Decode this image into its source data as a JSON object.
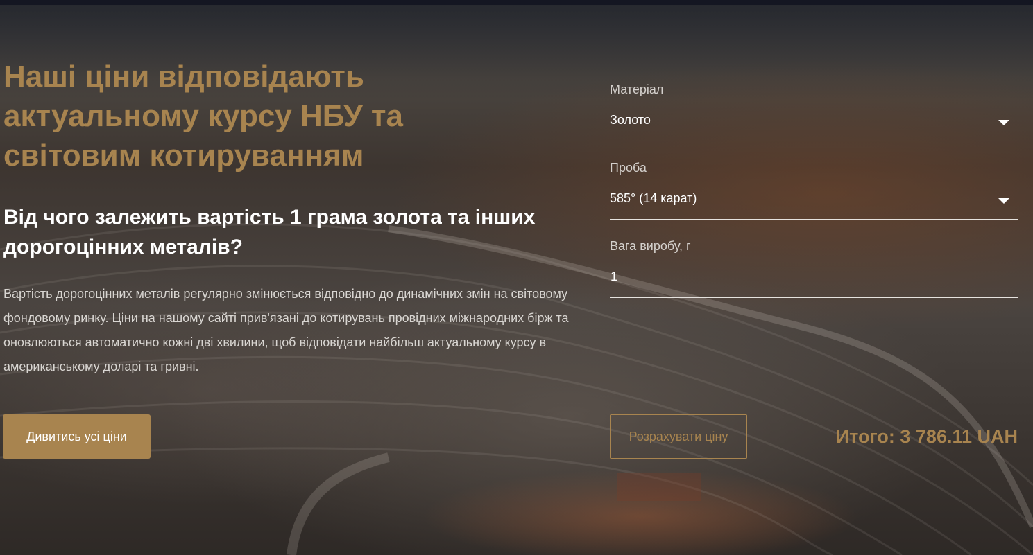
{
  "hero": {
    "title": "Наші ціни відповідають актуальному курсу НБУ та світовим котируванням",
    "subtitle": "Від чого залежить вартість 1 грама золота та інших дорогоцінних металів?",
    "body": "Вартість дорогоцінних металів регулярно змінюється відповідно до динамічних змін на світовому фондовому ринку. Ціни на нашому сайті прив'язані до котирувань провідних міжнародних бірж та оновлюються автоматично кожні дві хвилини, щоб відповідати найбільш актуальному курсу в американському доларі та гривні.",
    "cta_label": "Дивитись усі ціни"
  },
  "calculator": {
    "material_label": "Матеріал",
    "material_value": "Золото",
    "probe_label": "Проба",
    "probe_value": "585° (14 карат)",
    "weight_label": "Вага виробу, г",
    "weight_value": "1",
    "calc_button_label": "Розрахувати ціну",
    "total_text": "Итого: 3 786.11 UAH"
  },
  "colors": {
    "accent": "#a8844f",
    "text_light": "#ffffff",
    "topbar": "#141622"
  }
}
